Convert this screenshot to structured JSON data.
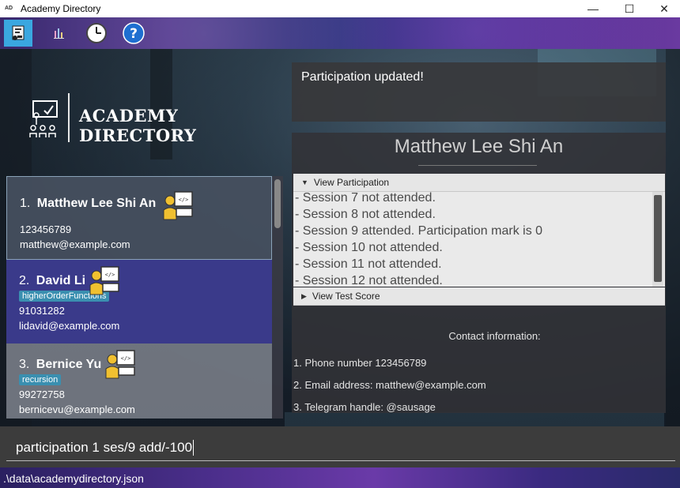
{
  "window": {
    "app_icon_text": "AD",
    "title": "Academy Directory",
    "minimize": "—",
    "maximize": "☐",
    "close": "✕"
  },
  "toolbar": {
    "items": [
      {
        "name": "directory",
        "icon": "directory-icon",
        "active": true
      },
      {
        "name": "visualize",
        "icon": "chart-icon",
        "active": false
      },
      {
        "name": "history",
        "icon": "clock-icon",
        "active": false
      },
      {
        "name": "help",
        "icon": "help-icon",
        "active": false
      }
    ]
  },
  "logo": {
    "brand": "ACADEMY DIRECTORY"
  },
  "students": [
    {
      "index": "1.",
      "name": "Matthew Lee Shi An",
      "tag": "",
      "phone": "123456789",
      "email": "matthew@example.com"
    },
    {
      "index": "2.",
      "name": "David Li",
      "tag": "higherOrderFunctions",
      "phone": "91031282",
      "email": "lidavid@example.com"
    },
    {
      "index": "3.",
      "name": "Bernice Yu",
      "tag": "recursion",
      "phone": "99272758",
      "email": "bernicevu@example.com"
    }
  ],
  "result": {
    "message": "Participation updated!"
  },
  "detail": {
    "name": "Matthew Lee Shi An",
    "participation_header": "View Participation",
    "participation_rows": [
      "- Session 7 not attended.",
      "- Session 8 not attended.",
      "- Session 9 attended. Participation mark is 0",
      "- Session 10 not attended.",
      "- Session 11 not attended.",
      "- Session 12 not attended."
    ],
    "test_score_header": "View Test Score",
    "contact_heading": "Contact information:",
    "contact_lines": [
      "1. Phone number 123456789",
      "2. Email address: matthew@example.com",
      "3. Telegram handle: @sausage"
    ]
  },
  "command": {
    "value": "participation 1 ses/9 add/-100"
  },
  "status": {
    "path": ".\\data\\academydirectory.json"
  },
  "colors": {
    "active_tool": "#3aa7e0",
    "selected_card": "#464f5f",
    "card2": "#3a3a8a",
    "tag": "#3a8fb0"
  }
}
